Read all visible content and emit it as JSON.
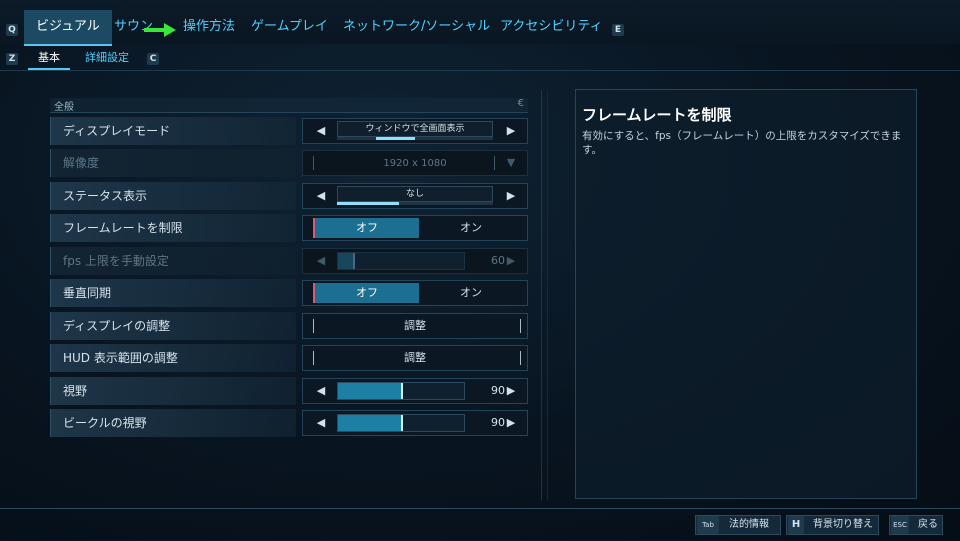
{
  "tabs": {
    "left_key": "Q",
    "right_key": "E",
    "items": [
      {
        "label": "ビジュアル"
      },
      {
        "label": "サウン"
      },
      {
        "label": "操作方法"
      },
      {
        "label": "ゲームプレイ"
      },
      {
        "label": "ネットワーク/ソーシャル"
      },
      {
        "label": "アクセシビリティ"
      }
    ]
  },
  "annotation": {
    "arrow_color": "#39e639"
  },
  "subtabs": {
    "left_key": "Z",
    "right_key": "C",
    "items": [
      {
        "label": "基本"
      },
      {
        "label": "詳細設定"
      }
    ]
  },
  "section": {
    "title": "全般",
    "corner_glyph": "€"
  },
  "rows": [
    {
      "label": "ディスプレイモード",
      "value": "ウィンドウで全画面表示",
      "progress": 0.25
    },
    {
      "label": "解像度",
      "value": "1920 x 1080"
    },
    {
      "label": "ステータス表示",
      "value": "なし",
      "progress": 0.4
    },
    {
      "label": "フレームレートを制限",
      "off": "オフ",
      "on": "オン"
    },
    {
      "label": "fps 上限を手動設定",
      "value": "60",
      "level": 0.12
    },
    {
      "label": "垂直同期",
      "off": "オフ",
      "on": "オン"
    },
    {
      "label": "ディスプレイの調整",
      "value": "調整"
    },
    {
      "label": "HUD 表示範囲の調整",
      "value": "調整"
    },
    {
      "label": "視野",
      "value": "90",
      "level": 0.5
    },
    {
      "label": "ビークルの視野",
      "value": "90",
      "level": 0.5
    }
  ],
  "info": {
    "title": "フレームレートを制限",
    "description": "有効にすると、fps（フレームレート）の上限をカスタマイズできます。"
  },
  "footer": {
    "legal_key": "Tab",
    "legal_label": "法的情報",
    "bg_key": "H",
    "bg_label": "背景切り替え",
    "back_key": "ESC",
    "back_label": "戻る"
  },
  "colors": {
    "accent": "#4fd1ff",
    "toggle_on": "#1c6f91",
    "slider_fill": "#1c7fa3"
  }
}
